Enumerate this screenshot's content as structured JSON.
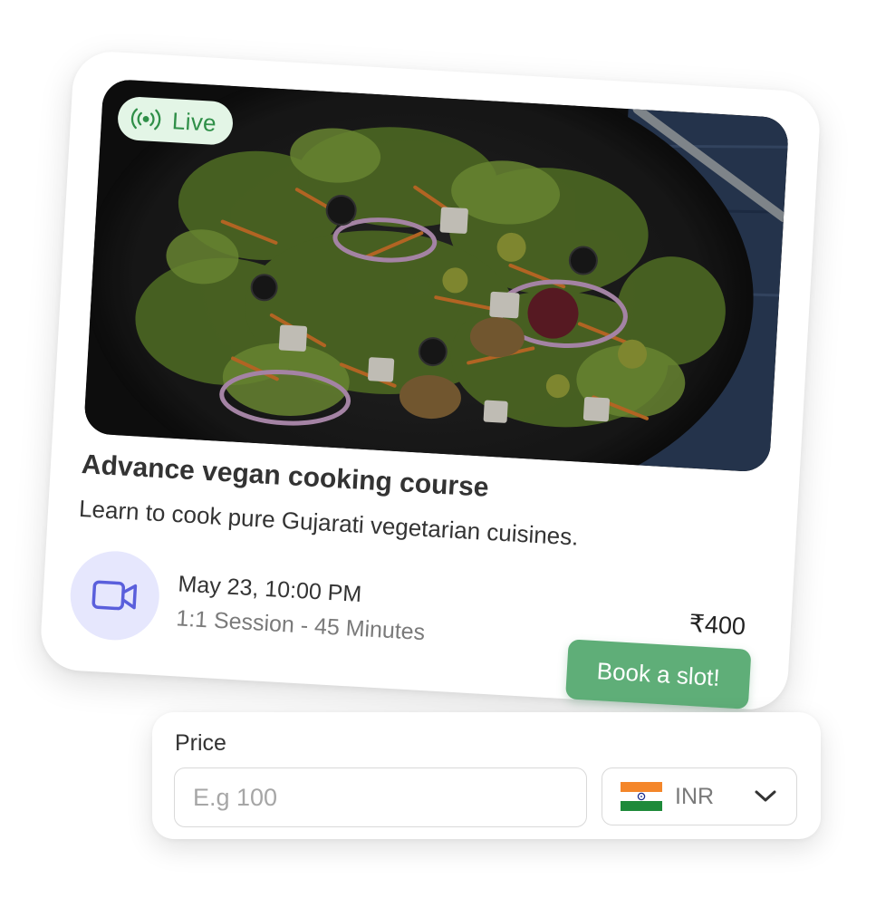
{
  "course": {
    "badge": "Live",
    "title": "Advance vegan cooking course",
    "description": "Learn to cook pure Gujarati vegetarian cuisines.",
    "date": "May 23, 10:00 PM",
    "session": "1:1 Session - 45 Minutes",
    "price": "₹400",
    "cta_label": "Book a slot!"
  },
  "price_form": {
    "label": "Price",
    "input_value": "",
    "input_placeholder": "E.g 100",
    "currency": "INR"
  },
  "icons": {
    "live": "broadcast-icon",
    "session": "video-camera-icon",
    "currency_flag": "india-flag-icon",
    "dropdown": "chevron-down-icon"
  },
  "colors": {
    "live_badge_bg": "#e3f5e6",
    "live_badge_text": "#2f8f48",
    "cta_bg": "#5fae78",
    "session_icon_bg": "#e6e7fd",
    "session_icon": "#5a5fdc"
  }
}
